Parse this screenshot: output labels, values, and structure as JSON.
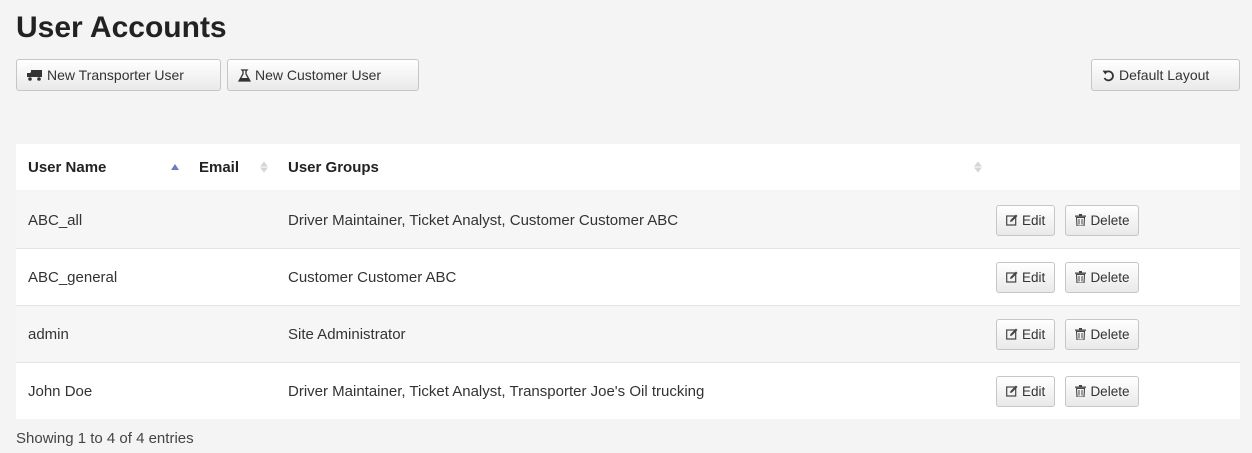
{
  "page": {
    "title": "User Accounts"
  },
  "toolbar": {
    "new_transporter_label": "New Transporter User",
    "new_customer_label": "New Customer User",
    "default_layout_label": "Default Layout"
  },
  "table": {
    "columns": [
      {
        "label": "User Name",
        "sort": "ascending"
      },
      {
        "label": "Email",
        "sort": "none"
      },
      {
        "label": "User Groups",
        "sort": "none"
      },
      {
        "label": "",
        "sort": "none"
      }
    ],
    "rows": [
      {
        "username": "ABC_all",
        "email": "",
        "groups": "Driver Maintainer, Ticket Analyst, Customer Customer ABC"
      },
      {
        "username": "ABC_general",
        "email": "",
        "groups": "Customer Customer ABC"
      },
      {
        "username": "admin",
        "email": "",
        "groups": "Site Administrator"
      },
      {
        "username": "John Doe",
        "email": "",
        "groups": "Driver Maintainer, Ticket Analyst, Transporter Joe's Oil trucking"
      }
    ],
    "row_actions": {
      "edit_label": "Edit",
      "delete_label": "Delete"
    }
  },
  "footer": {
    "info": "Showing 1 to 4 of 4 entries"
  },
  "colors": {
    "sort_active": "#6c7ac9",
    "sort_inactive": "#d5d5d5",
    "stripe": "#f6f6f6",
    "background": "#f4f4f4"
  },
  "icons": {
    "new_transporter": "truck-icon",
    "new_customer": "flask-icon",
    "default_layout": "undo-icon",
    "edit": "edit-icon",
    "delete": "trash-icon"
  }
}
